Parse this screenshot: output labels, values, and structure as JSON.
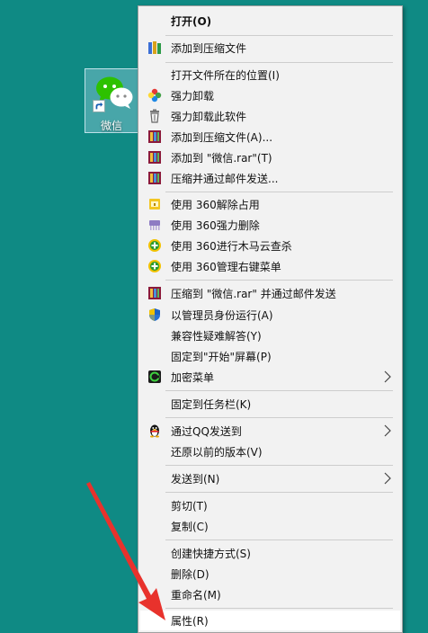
{
  "desktop": {
    "icon_label": "微信"
  },
  "menu": {
    "items": [
      {
        "label": "打开(O)",
        "icon": "none",
        "bold": true
      },
      {
        "label": "添加到压缩文件",
        "icon": "winrar-books-icon"
      },
      {
        "label": "打开文件所在的位置(I)",
        "icon": "none"
      },
      {
        "label": "强力卸载",
        "icon": "clover-uninstall-icon"
      },
      {
        "label": "强力卸载此软件",
        "icon": "trash-bin-icon"
      },
      {
        "label": "添加到压缩文件(A)...",
        "icon": "winrar-icon"
      },
      {
        "label": "添加到 \"微信.rar\"(T)",
        "icon": "winrar-icon"
      },
      {
        "label": "压缩并通过邮件发送...",
        "icon": "winrar-icon"
      },
      {
        "label": "使用 360解除占用",
        "icon": "unlock-file-icon"
      },
      {
        "label": "使用 360强力删除",
        "icon": "shred-icon"
      },
      {
        "label": "使用 360进行木马云查杀",
        "icon": "360-plus-icon"
      },
      {
        "label": "使用 360管理右键菜单",
        "icon": "360-plus-icon"
      },
      {
        "label": "压缩到 \"微信.rar\" 并通过邮件发送",
        "icon": "winrar-icon"
      },
      {
        "label": "以管理员身份运行(A)",
        "icon": "uac-shield-icon"
      },
      {
        "label": "兼容性疑难解答(Y)",
        "icon": "none"
      },
      {
        "label": "固定到\"开始\"屏幕(P)",
        "icon": "none"
      },
      {
        "label": "加密菜单",
        "icon": "encrypt-icon",
        "submenu": true
      },
      {
        "label": "固定到任务栏(K)",
        "icon": "none"
      },
      {
        "label": "通过QQ发送到",
        "icon": "qq-penguin-icon",
        "submenu": true
      },
      {
        "label": "还原以前的版本(V)",
        "icon": "none"
      },
      {
        "label": "发送到(N)",
        "icon": "none",
        "submenu": true
      },
      {
        "label": "剪切(T)",
        "icon": "none"
      },
      {
        "label": "复制(C)",
        "icon": "none"
      },
      {
        "label": "创建快捷方式(S)",
        "icon": "none"
      },
      {
        "label": "删除(D)",
        "icon": "none"
      },
      {
        "label": "重命名(M)",
        "icon": "none"
      },
      {
        "label": "属性(R)",
        "icon": "none",
        "highlighted": true
      }
    ]
  },
  "colors": {
    "desktop": "#0f8a84",
    "menu_bg": "#f2f2f2",
    "highlight": "#ffffff",
    "arrow": "#e8322c"
  }
}
